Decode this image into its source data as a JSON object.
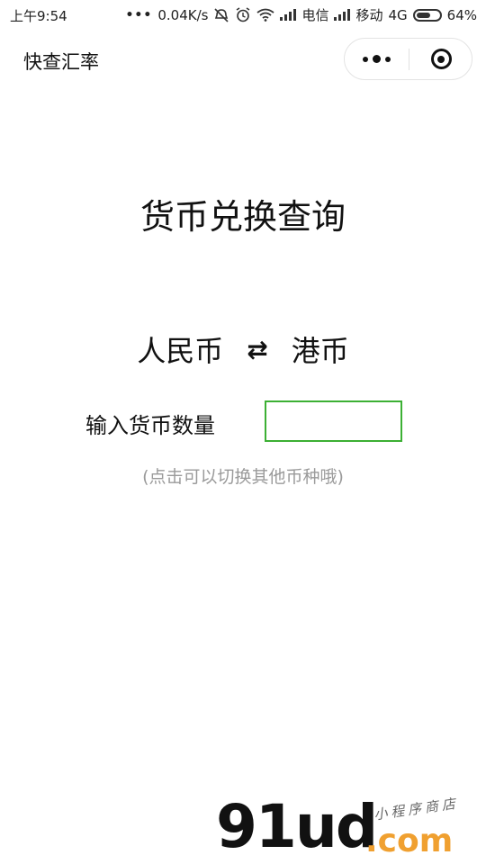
{
  "status_bar": {
    "time": "上午9:54",
    "speed": "0.04K/s",
    "carrier1": "电信",
    "carrier2": "移动",
    "network": "4G",
    "battery_text": "64%",
    "battery_level": 0.64,
    "icons": [
      "more-dots-icon",
      "mute-icon",
      "alarm-icon",
      "wifi-icon",
      "signal-icon",
      "battery-icon"
    ]
  },
  "nav": {
    "title": "快查汇率"
  },
  "main": {
    "title": "货币兑换查询",
    "from_currency": "人民币",
    "swap_symbol": "⇄",
    "to_currency": "港币",
    "amount_label": "输入货币数量",
    "amount_value": "",
    "hint": "(点击可以切换其他币种哦)"
  },
  "watermark": {
    "main": "91ud",
    "suffix": ".com",
    "sub": "小程序商店"
  },
  "colors": {
    "input_border": "#3cb034",
    "hint": "#9a9a9a",
    "watermark_green": "#3cc6b0",
    "watermark_orange": "#f0a030"
  }
}
